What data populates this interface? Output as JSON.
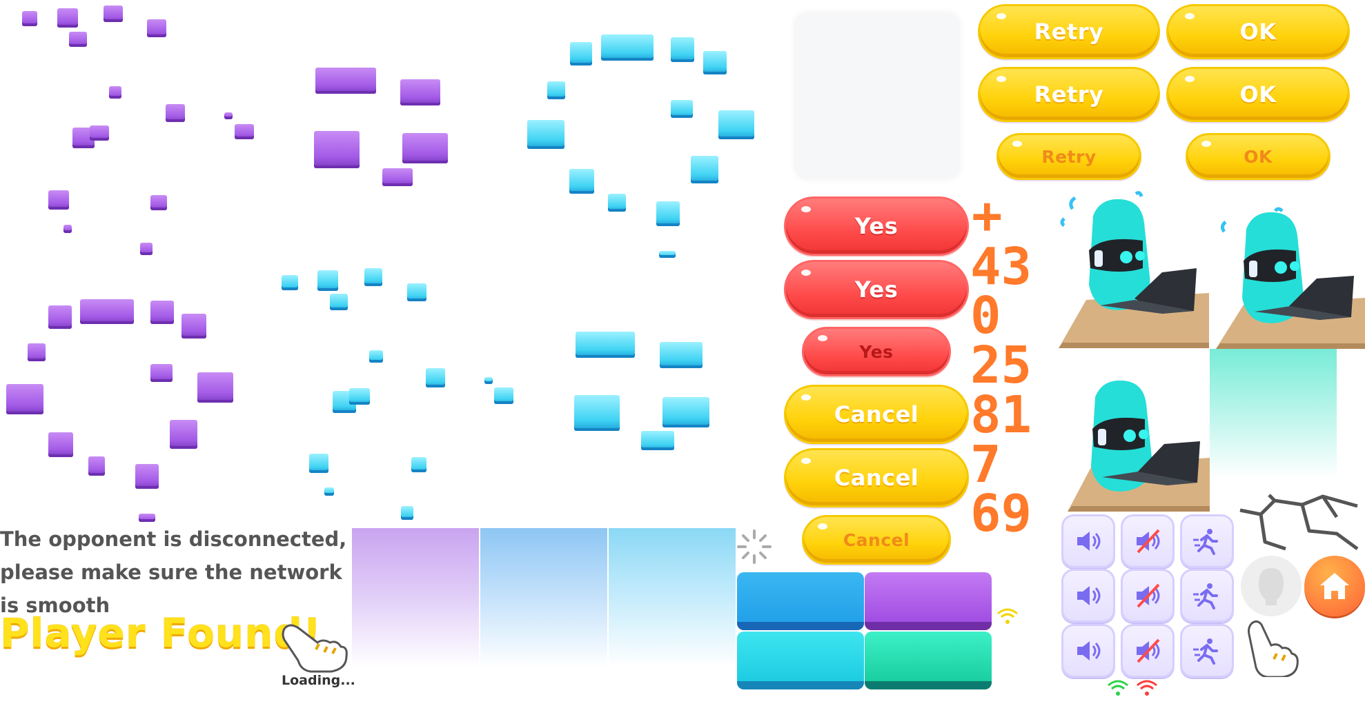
{
  "disconnect_message": "The opponent is disconnected, please make sure the network is smooth",
  "player_found": "Player Found!",
  "loading": "Loading...",
  "buttons": {
    "retry": "Retry",
    "ok": "OK",
    "yes": "Yes",
    "cancel": "Cancel"
  },
  "digits": [
    "+",
    "43",
    "0",
    "25",
    "81",
    "7",
    "69"
  ],
  "icons": {
    "sound_on": "speaker-icon",
    "sound_off": "speaker-muted-icon",
    "exit": "running-exit-icon",
    "home": "home-icon",
    "wifi": "wifi-icon",
    "spinner": "loading-spinner-icon",
    "pointer": "pointing-hand-icon"
  },
  "colors": {
    "yellow": "#ffd20a",
    "red": "#ff4b4b",
    "purple": "#a35ae6",
    "cyan": "#40d3f3",
    "orange_digits": "#ff7a2a",
    "home_button": "#ff7a3c"
  }
}
